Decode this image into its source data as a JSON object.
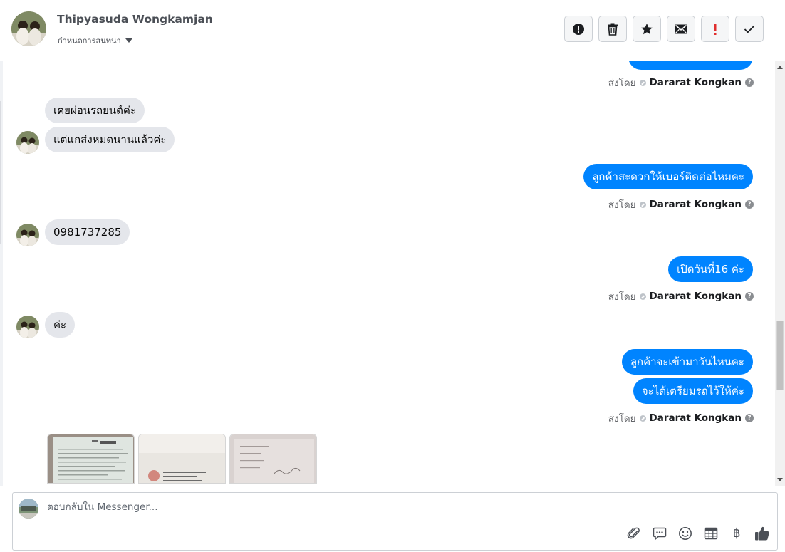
{
  "header": {
    "contact_name": "Thipyasuda Wongkamjan",
    "subtitle": "กำหนดการสนทนา",
    "actions": [
      {
        "icon": "exclamation-circle-icon"
      },
      {
        "icon": "trash-icon"
      },
      {
        "icon": "star-icon"
      },
      {
        "icon": "envelope-icon"
      },
      {
        "icon": "spam-exclamation-icon"
      },
      {
        "icon": "check-icon"
      }
    ]
  },
  "sent_by": {
    "prefix": "ส่งโดย",
    "agent": "Dararat Kongkan",
    "help": "?"
  },
  "messages": {
    "in_1": "เคยผ่อนรถยนต์ค่ะ",
    "in_2": "แต่แกส่งหมดนานแล้วค่ะ",
    "out_1": "ลูกค้าสะดวกให้เบอร์ติดต่อไหมคะ",
    "in_3": "0981737285",
    "out_2": "เปิดวันที่16 ค่ะ",
    "in_4": "ค่ะ",
    "out_3": "ลูกค้าจะเข้ามาวันไหนคะ",
    "out_4": "จะได้เตรียมรถไว้ให้ค่ะ"
  },
  "composer": {
    "placeholder": "ตอบกลับใน Messenger...",
    "tools": [
      "paperclip-icon",
      "chat-bubble-icon",
      "emoji-icon",
      "table-icon",
      "baht-icon",
      "thumbs-up-icon"
    ],
    "baht_symbol": "฿"
  },
  "colors": {
    "outgoing_bubble": "#0084ff",
    "incoming_bubble": "#e4e6eb",
    "spam_icon": "#e02e2e"
  }
}
